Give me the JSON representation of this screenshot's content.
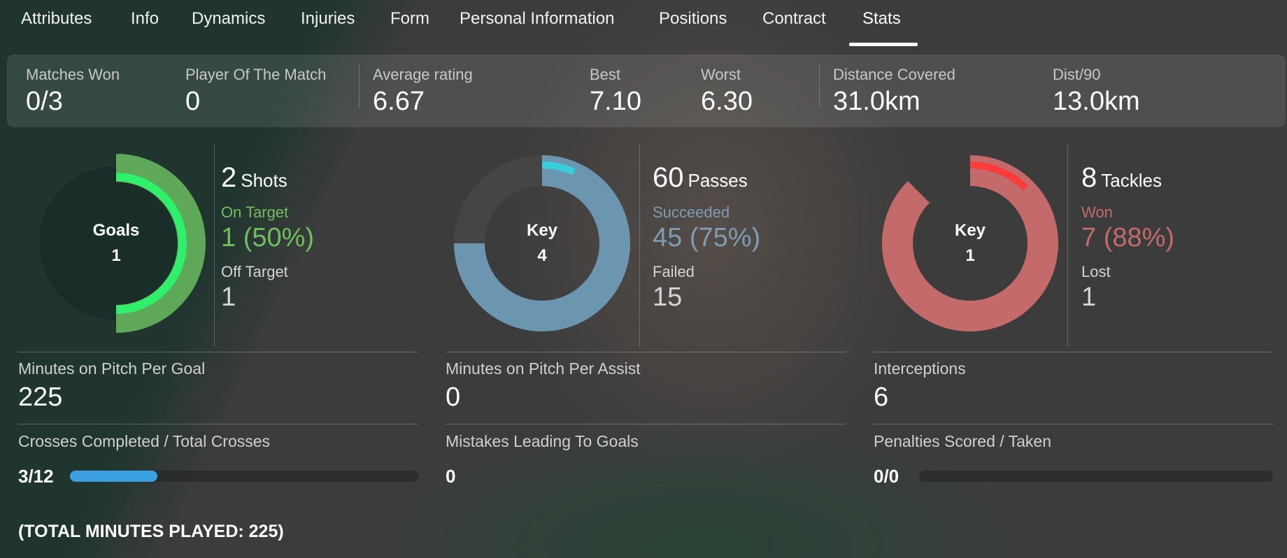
{
  "tabs": [
    "Attributes",
    "Info",
    "Dynamics",
    "Injuries",
    "Form",
    "Personal Information",
    "Positions",
    "Contract",
    "Stats"
  ],
  "active_tab": "Stats",
  "summary": {
    "matches_won": {
      "label": "Matches Won",
      "value": "0/3"
    },
    "potm": {
      "label": "Player Of The Match",
      "value": "0"
    },
    "avg_rating": {
      "label": "Average rating",
      "value": "6.67"
    },
    "best": {
      "label": "Best",
      "value": "7.10"
    },
    "worst": {
      "label": "Worst",
      "value": "6.30"
    },
    "distance": {
      "label": "Distance Covered",
      "value": "31.0km"
    },
    "dist90": {
      "label": "Dist/90",
      "value": "13.0km"
    }
  },
  "shots": {
    "donut_label": "Goals",
    "donut_value": "1",
    "count": "2",
    "unit": "Shots",
    "on_target_label": "On Target",
    "on_target_value": "1 (50%)",
    "off_target_label": "Off Target",
    "off_target_value": "1",
    "on_target_fraction": 0.5,
    "goal_fraction": 0.5
  },
  "passes": {
    "donut_label": "Key",
    "donut_value": "4",
    "count": "60",
    "unit": "Passes",
    "succeeded_label": "Succeeded",
    "succeeded_value": "45 (75%)",
    "failed_label": "Failed",
    "failed_value": "15",
    "success_fraction": 0.75,
    "key_fraction": 0.067
  },
  "tackles": {
    "donut_label": "Key",
    "donut_value": "1",
    "count": "8",
    "unit": "Tackles",
    "won_label": "Won",
    "won_value": "7 (88%)",
    "lost_label": "Lost",
    "lost_value": "1",
    "won_fraction": 0.875,
    "key_fraction": 0.125
  },
  "grid": {
    "mins_per_goal": {
      "label": "Minutes on Pitch Per Goal",
      "value": "225"
    },
    "mins_per_assist": {
      "label": "Minutes on Pitch Per Assist",
      "value": "0"
    },
    "interceptions": {
      "label": "Interceptions",
      "value": "6"
    },
    "crosses": {
      "label": "Crosses Completed / Total Crosses",
      "value": "3/12",
      "fraction": 0.25
    },
    "mistakes": {
      "label": "Mistakes Leading To Goals",
      "value": "0"
    },
    "penalties": {
      "label": "Penalties Scored / Taken",
      "value": "0/0",
      "fraction": 0
    }
  },
  "total_minutes": "(TOTAL MINUTES PLAYED: 225)",
  "colors": {
    "goals_green": "#2ef06a",
    "goals_outer": "#5fa85a",
    "passes_blue": "#6c95b0",
    "passes_key": "#36d0dc",
    "tackles_red": "#c46a6a",
    "tackles_key": "#ff3b3b",
    "cross_bar": "#3aa0e0"
  }
}
